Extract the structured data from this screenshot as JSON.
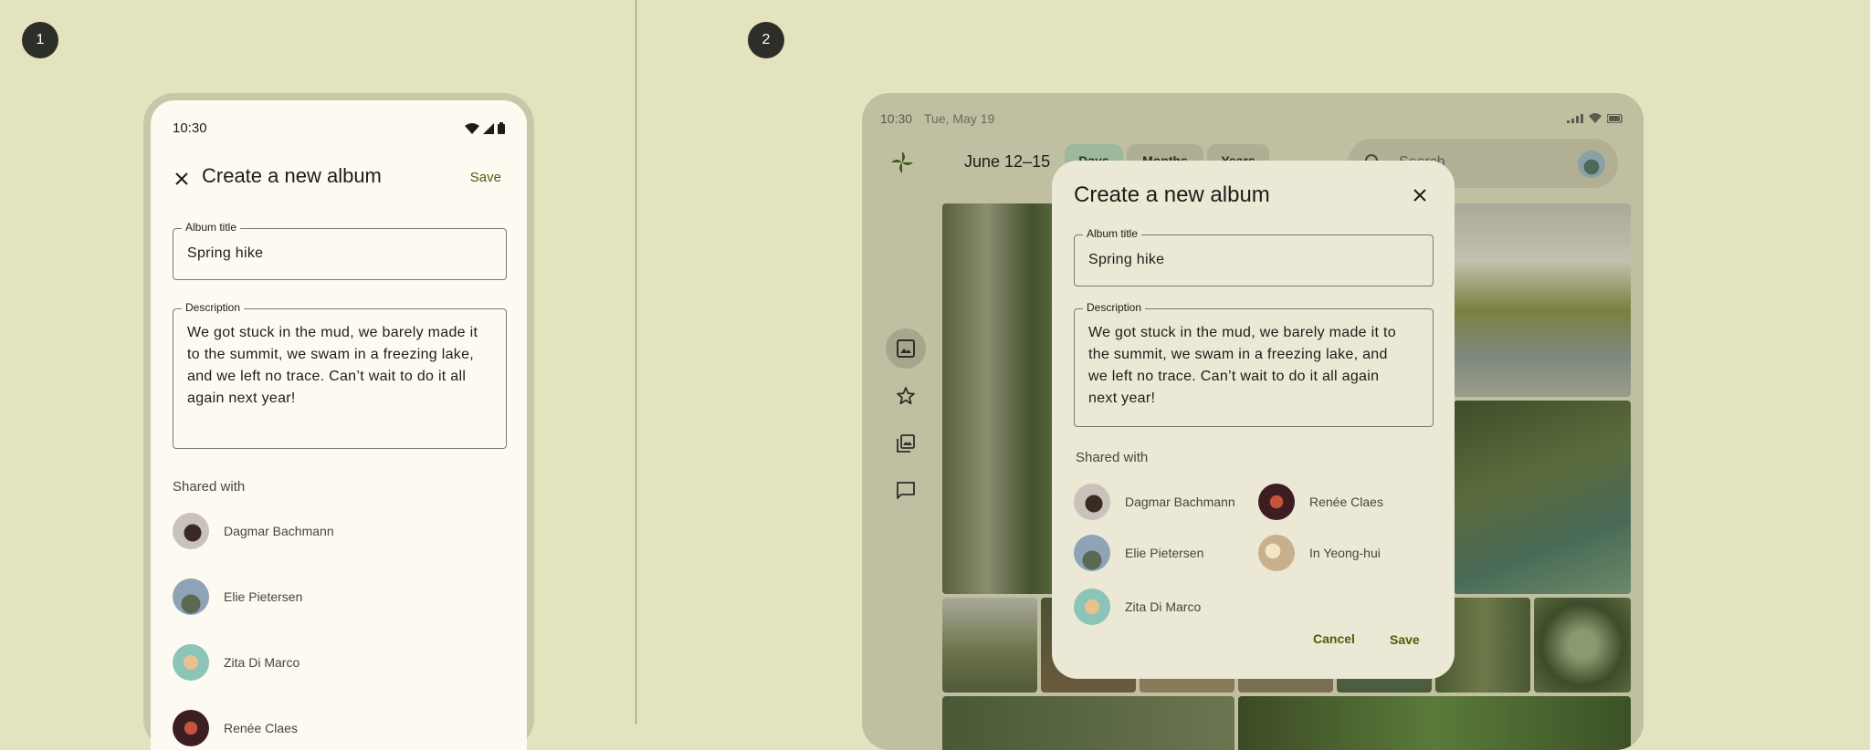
{
  "steps": [
    "1",
    "2"
  ],
  "phone": {
    "status_time": "10:30",
    "title": "Create a new album",
    "save_label": "Save",
    "album_title_label": "Album title",
    "album_title_value": "Spring hike",
    "description_label": "Description",
    "description_lines": [
      "We got stuck in the mud, we barely made it",
      "to the summit, we swam in a freezing lake,",
      "and we left no trace. Can’t wait to do it all",
      "again next year!"
    ],
    "shared_with_label": "Shared with",
    "people": [
      "Dagmar Bachmann",
      "Elie Pietersen",
      "Zita Di Marco",
      "Renée Claes"
    ]
  },
  "tablet": {
    "status_time": "10:30",
    "status_date": "Tue, May 19",
    "date_range": "June 12–15",
    "chips": [
      "Days",
      "Months",
      "Years"
    ],
    "search_placeholder": "Search",
    "rail": [
      "photos-icon",
      "star-icon",
      "library-icon",
      "message-icon"
    ]
  },
  "dialog": {
    "title": "Create a new album",
    "album_title_label": "Album title",
    "album_title_value": "Spring hike",
    "description_label": "Description",
    "description_lines": [
      "We got stuck in the mud, we barely made it to",
      "the summit, we swam in a freezing lake, and",
      "we left no trace. Can’t wait to do it all again",
      "next year!"
    ],
    "shared_with_label": "Shared with",
    "people": [
      "Dagmar Bachmann",
      "Renée Claes",
      "Elie Pietersen",
      "In Yeong-hui",
      "Zita Di Marco"
    ],
    "cancel_label": "Cancel",
    "save_label": "Save"
  }
}
